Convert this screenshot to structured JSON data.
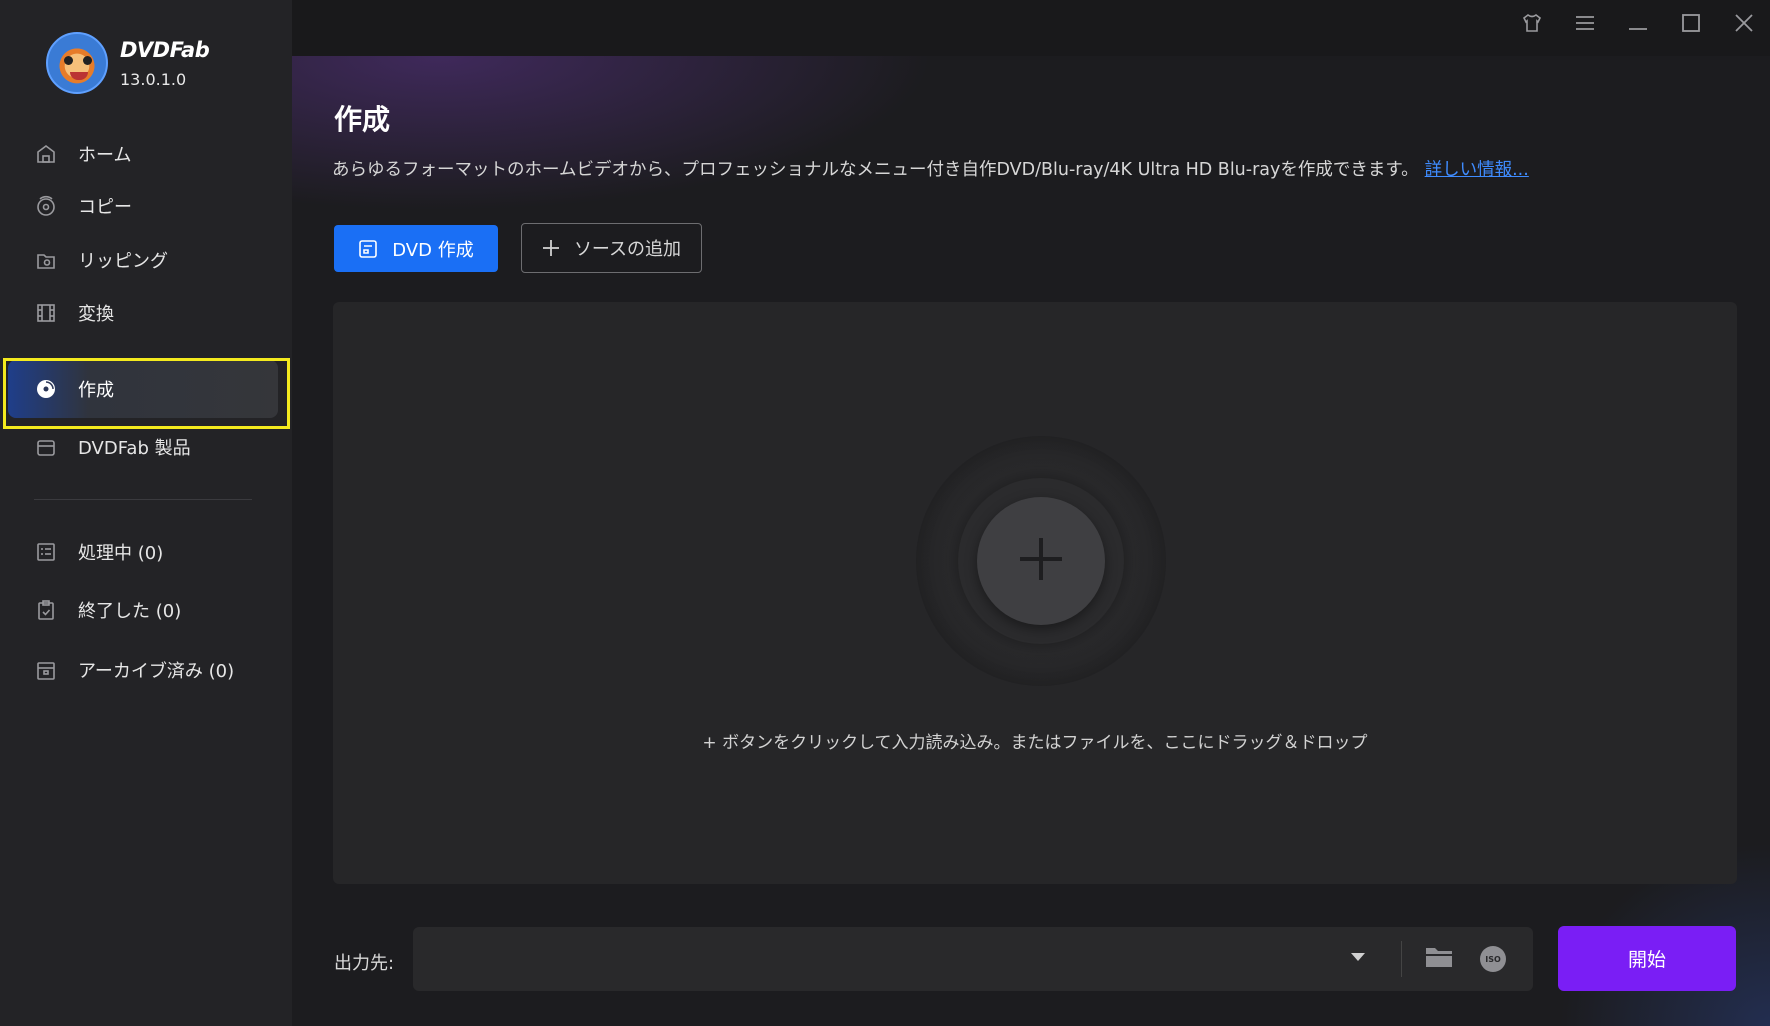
{
  "app": {
    "name": "DVDFab",
    "version": "13.0.1.0"
  },
  "sidebar": {
    "items": [
      {
        "label": "ホーム",
        "icon": "home-icon"
      },
      {
        "label": "コピー",
        "icon": "copy-disc-icon"
      },
      {
        "label": "リッピング",
        "icon": "ripper-icon"
      },
      {
        "label": "変換",
        "icon": "film-icon"
      },
      {
        "label": "作成",
        "icon": "creator-disc-icon",
        "active": true
      },
      {
        "label": "DVDFab 製品",
        "icon": "products-box-icon"
      }
    ],
    "queue": [
      {
        "label": "処理中 (0)",
        "icon": "processing-list-icon"
      },
      {
        "label": "終了した (0)",
        "icon": "finished-clipboard-icon"
      },
      {
        "label": "アーカイブ済み (0)",
        "icon": "archive-box-icon"
      }
    ]
  },
  "titlebar": {
    "buttons": [
      "skin-icon",
      "menu-icon",
      "minimize-icon",
      "maximize-icon",
      "close-icon"
    ]
  },
  "main": {
    "title": "作成",
    "description": "あらゆるフォーマットのホームビデオから、プロフェッショナルなメニュー付き自作DVD/Blu-ray/4K Ultra HD Blu-rayを作成できます。",
    "more_info_link": "詳しい情報...",
    "create_button": "DVD 作成",
    "add_source_button": "ソースの追加",
    "drop_hint": "+ ボタンをクリックして入力読み込み。またはファイルを、ここにドラッグ＆ドロップ",
    "output_label": "出力先:",
    "output_value": "",
    "iso_label": "ISO",
    "start_button": "開始"
  },
  "colors": {
    "accent_blue": "#1a6ff5",
    "start_purple": "#7a1ef5",
    "highlight_yellow": "#f4ea1e",
    "link_blue": "#3f8cff"
  }
}
